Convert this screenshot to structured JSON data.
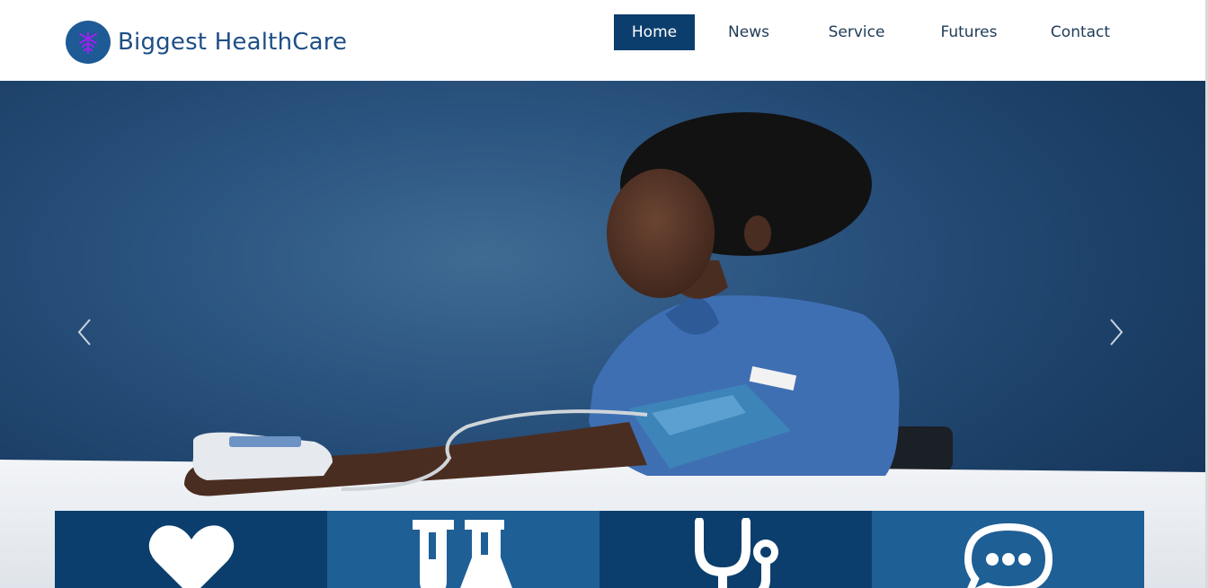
{
  "brand": {
    "name": "Biggest  HealthCare",
    "logo_icon": "caduceus-icon"
  },
  "nav": {
    "items": [
      {
        "label": "Home",
        "active": true
      },
      {
        "label": "News",
        "active": false
      },
      {
        "label": "Service",
        "active": false
      },
      {
        "label": "Futures",
        "active": false
      },
      {
        "label": "Contact",
        "active": false
      }
    ]
  },
  "hero": {
    "image": "nurse-blood-pressure-photo",
    "prev_icon": "chevron-left-icon",
    "next_icon": "chevron-right-icon"
  },
  "features": [
    {
      "icon": "heart-icon"
    },
    {
      "icon": "lab-flask-icon"
    },
    {
      "icon": "stethoscope-icon"
    },
    {
      "icon": "chat-bubble-icon"
    }
  ],
  "colors": {
    "primary": "#0b3e6c",
    "secondary": "#1e5f96",
    "brand_text": "#1e4f86",
    "logo_mark": "#a020f0"
  }
}
